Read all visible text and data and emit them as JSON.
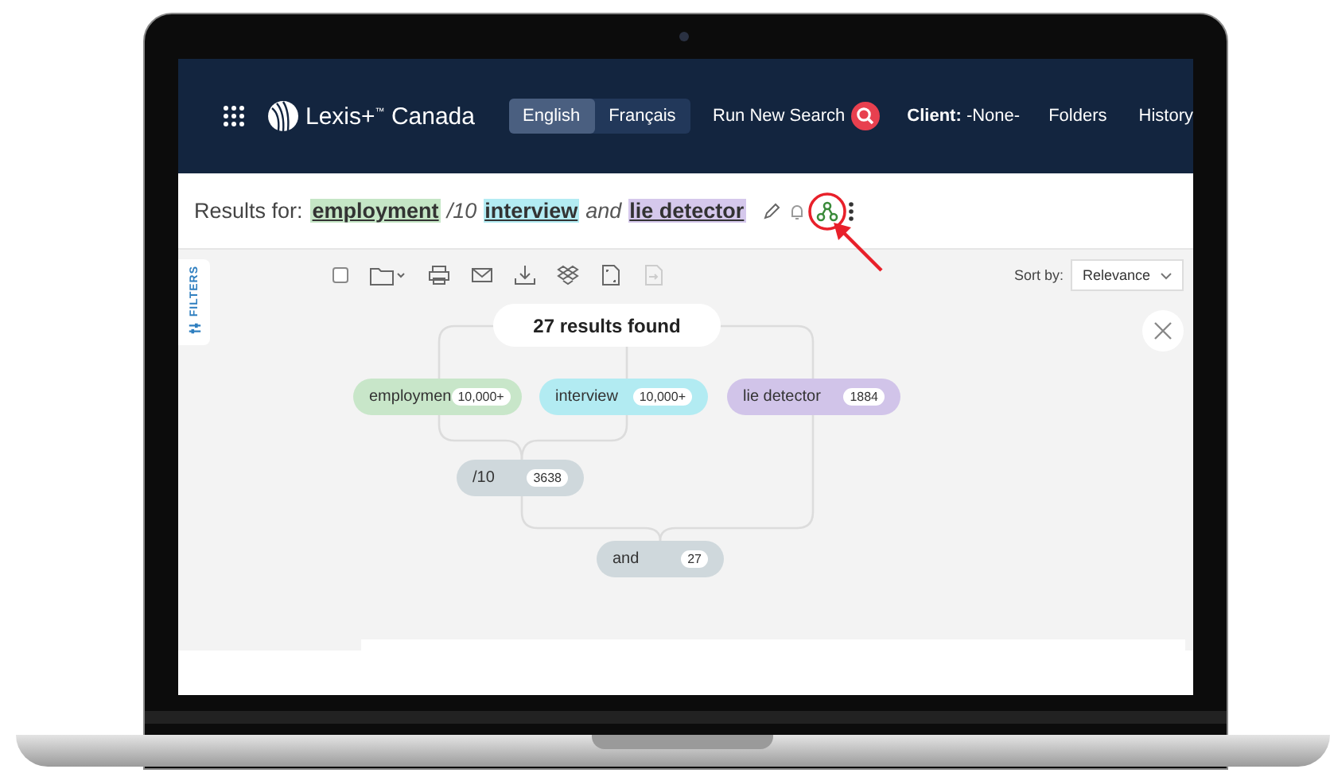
{
  "nav": {
    "logo": "Lexis+$^{™}$ Canada",
    "languages": [
      {
        "label": "English",
        "selected": true
      },
      {
        "label": "Français",
        "selected": false
      }
    ],
    "links": [
      {
        "kind": "search",
        "label": "Run New Search"
      },
      {
        "kind": "client",
        "label": "**Client:** -None-"
      },
      {
        "kind": "plain",
        "label": "Folders"
      },
      {
        "kind": "plain",
        "label": "History"
      }
    ]
  },
  "results_header": {
    "prefix": "Results for:",
    "query": [
      {
        "kind": "term",
        "text": "employment",
        "color": "#c5e6c6"
      },
      {
        "kind": "operator",
        "text": "/10"
      },
      {
        "kind": "term",
        "text": "interview",
        "color": "#b3ecf3"
      },
      {
        "kind": "operator",
        "text": "and"
      },
      {
        "kind": "term",
        "text": "lie detector",
        "color": "#d5c8ec"
      }
    ]
  },
  "filters_tab": {
    "label": "FILTERS"
  },
  "toolbar": {
    "select_all": {
      "checked": false
    },
    "sort": {
      "label": "Sort by:",
      "value": "Relevance"
    }
  },
  "diagram": {
    "summary": "27 results found",
    "nodes": [
      {
        "label": "employmen",
        "count": "10,000+",
        "color": "#c8e6c9"
      },
      {
        "label": "interview",
        "count": "10,000+",
        "color": "#b2ebf2"
      },
      {
        "label": "lie detector",
        "count": "1884",
        "color": "#d1c4e9"
      },
      {
        "label": "/10",
        "count": "3638",
        "color": "#cfd8dc"
      },
      {
        "label": "and",
        "count": "27",
        "color": "#cfd8dc"
      }
    ]
  }
}
